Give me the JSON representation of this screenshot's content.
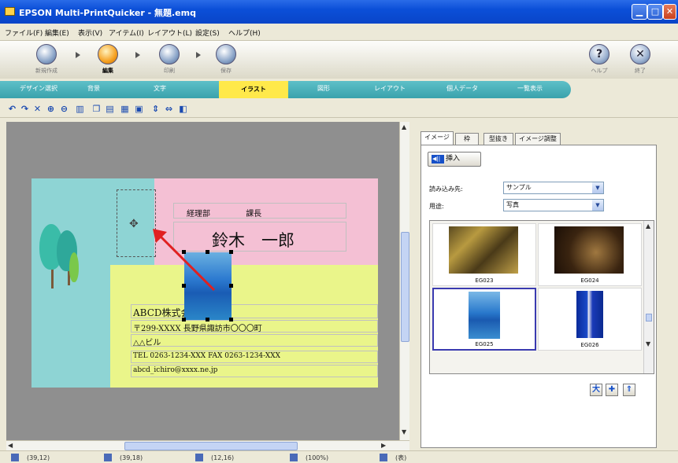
{
  "window": {
    "title": "EPSON Multi-PrintQuicker - 無題.emq"
  },
  "menu": [
    "ファイル(F)",
    "編集(E)",
    "表示(V)",
    "アイテム(I)",
    "レイアウト(L)",
    "設定(S)",
    "ヘルプ(H)"
  ],
  "steps": [
    {
      "label": "新規作成",
      "active": false
    },
    {
      "label": "編集",
      "active": true
    },
    {
      "label": "印刷",
      "active": false
    },
    {
      "label": "保存",
      "active": false
    }
  ],
  "help": {
    "label": "ヘルプ",
    "icon": "?"
  },
  "exit": {
    "label": "終了",
    "icon": "✕"
  },
  "tabs": [
    "デザイン選択",
    "背景",
    "文字",
    "イラスト",
    "図形",
    "レイアウト",
    "個人データ",
    "一覧表示"
  ],
  "active_tab": "イラスト",
  "toolbar_icons": [
    "undo-icon",
    "redo-icon",
    "delete-icon",
    "zoom-in-icon",
    "zoom-out-icon",
    "trash-icon",
    "copy-icon",
    "paste-icon",
    "group-icon",
    "image-icon",
    "align-icon",
    "flip-icon",
    "layer-icon"
  ],
  "card": {
    "dept": "経理部",
    "role": "課長",
    "name": "鈴木　一郎",
    "company": "ABCD株式会社",
    "address": "〒299-XXXX 長野県諏訪市〇〇〇町",
    "building": "△△ビル",
    "phone": "TEL 0263-1234-XXX FAX 0263-1234-XXX",
    "email": "abcd_ichiro@xxxx.ne.jp"
  },
  "panel": {
    "tabs": [
      "イメージ",
      "枠",
      "型抜き",
      "イメージ調整"
    ],
    "insert_label": "挿入",
    "source_label": "読み込み先:",
    "source_value": "サンプル",
    "use_label": "用途:",
    "use_value": "写真",
    "thumbnails": [
      {
        "caption": "EG023",
        "selected": false
      },
      {
        "caption": "EG024",
        "selected": false
      },
      {
        "caption": "EG025",
        "selected": true
      },
      {
        "caption": "EG026",
        "selected": false
      }
    ]
  },
  "status": [
    "(39,12)",
    "(39,18)",
    "(12,16)",
    "(100%)",
    "(表)"
  ]
}
